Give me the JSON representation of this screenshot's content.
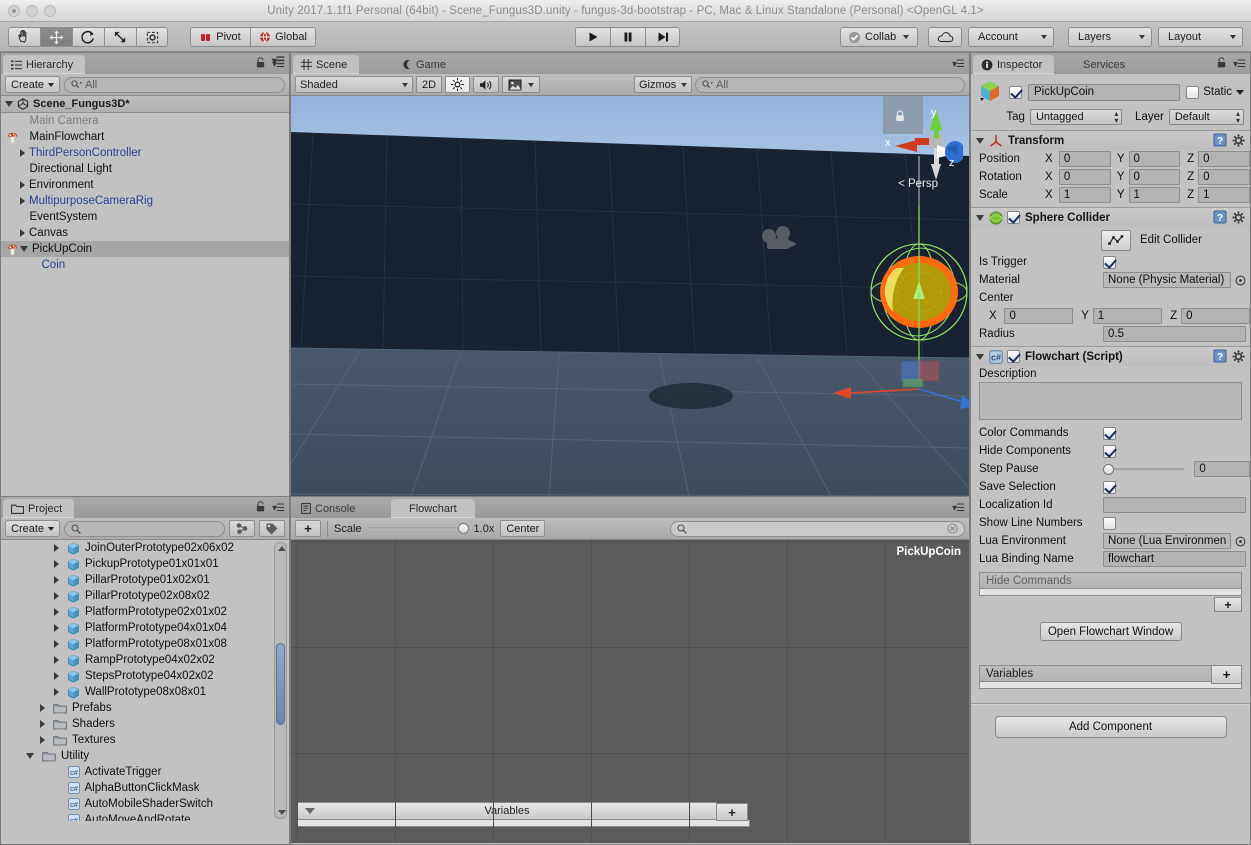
{
  "window": {
    "title": "Unity 2017.1.1f1 Personal (64bit) - Scene_Fungus3D.unity - fungus-3d-bootstrap - PC, Mac & Linux Standalone (Personal) <OpenGL 4.1>"
  },
  "toolbar": {
    "tools": [
      "hand-tool",
      "move-tool",
      "rotate-tool",
      "scale-tool",
      "rect-tool"
    ],
    "pivot_label": "Pivot",
    "global_label": "Global",
    "play_label": "play",
    "pause_label": "pause",
    "step_label": "step",
    "collab_label": "Collab",
    "cloud_label": "cloud",
    "account_label": "Account",
    "layers_label": "Layers",
    "layout_label": "Layout"
  },
  "hierarchy": {
    "tab_label": "Hierarchy",
    "create_label": "Create",
    "search_placeholder": "All",
    "scene_name": "Scene_Fungus3D*",
    "items": [
      {
        "label": "Main Camera",
        "indent": 1,
        "arrow": false,
        "icon": "none",
        "style": "dim",
        "selected": false
      },
      {
        "label": "MainFlowchart",
        "indent": 1,
        "arrow": false,
        "icon": "mushroom",
        "style": "normal",
        "selected": false
      },
      {
        "label": "ThirdPersonController",
        "indent": 1,
        "arrow": true,
        "icon": "none",
        "style": "prefab",
        "selected": false
      },
      {
        "label": "Directional Light",
        "indent": 1,
        "arrow": false,
        "icon": "none",
        "style": "normal",
        "selected": false
      },
      {
        "label": "Environment",
        "indent": 1,
        "arrow": true,
        "icon": "none",
        "style": "normal",
        "selected": false
      },
      {
        "label": "MultipurposeCameraRig",
        "indent": 1,
        "arrow": true,
        "icon": "none",
        "style": "prefab",
        "selected": false
      },
      {
        "label": "EventSystem",
        "indent": 1,
        "arrow": false,
        "icon": "none",
        "style": "normal",
        "selected": false
      },
      {
        "label": "Canvas",
        "indent": 1,
        "arrow": true,
        "icon": "none",
        "style": "normal",
        "selected": false
      },
      {
        "label": "PickUpCoin",
        "indent": 1,
        "arrow": true,
        "arrow_open": true,
        "icon": "mushroom",
        "style": "normal",
        "selected": true
      },
      {
        "label": "Coin",
        "indent": 2,
        "arrow": false,
        "icon": "none",
        "style": "prefab",
        "selected": false
      }
    ]
  },
  "project": {
    "tab_label": "Project",
    "create_label": "Create",
    "search_placeholder": "",
    "items": [
      {
        "label": "JoinOuterPrototype02x06x02",
        "indent": 3,
        "arrow": true,
        "icon": "prefab"
      },
      {
        "label": "PickupPrototype01x01x01",
        "indent": 3,
        "arrow": true,
        "icon": "prefab"
      },
      {
        "label": "PillarPrototype01x02x01",
        "indent": 3,
        "arrow": true,
        "icon": "prefab"
      },
      {
        "label": "PillarPrototype02x08x02",
        "indent": 3,
        "arrow": true,
        "icon": "prefab"
      },
      {
        "label": "PlatformPrototype02x01x02",
        "indent": 3,
        "arrow": true,
        "icon": "prefab"
      },
      {
        "label": "PlatformPrototype04x01x04",
        "indent": 3,
        "arrow": true,
        "icon": "prefab"
      },
      {
        "label": "PlatformPrototype08x01x08",
        "indent": 3,
        "arrow": true,
        "icon": "prefab"
      },
      {
        "label": "RampPrototype04x02x02",
        "indent": 3,
        "arrow": true,
        "icon": "prefab"
      },
      {
        "label": "StepsPrototype04x02x02",
        "indent": 3,
        "arrow": true,
        "icon": "prefab"
      },
      {
        "label": "WallPrototype08x08x01",
        "indent": 3,
        "arrow": true,
        "icon": "prefab"
      },
      {
        "label": "Prefabs",
        "indent": 2,
        "arrow": true,
        "icon": "folder"
      },
      {
        "label": "Shaders",
        "indent": 2,
        "arrow": true,
        "icon": "folder"
      },
      {
        "label": "Textures",
        "indent": 2,
        "arrow": true,
        "icon": "folder"
      },
      {
        "label": "Utility",
        "indent": 1,
        "arrow": true,
        "arrow_open": true,
        "icon": "folder"
      },
      {
        "label": "ActivateTrigger",
        "indent": 3,
        "arrow": false,
        "icon": "script"
      },
      {
        "label": "AlphaButtonClickMask",
        "indent": 3,
        "arrow": false,
        "icon": "script"
      },
      {
        "label": "AutoMobileShaderSwitch",
        "indent": 3,
        "arrow": false,
        "icon": "script"
      },
      {
        "label": "AutoMoveAndRotate",
        "indent": 3,
        "arrow": false,
        "icon": "script"
      }
    ]
  },
  "scene": {
    "tab_label": "Scene",
    "game_tab_label": "Game",
    "shading_mode": "Shaded",
    "twod_label": "2D",
    "light_label": "light-toggle",
    "audio_label": "audio-toggle",
    "fx_label": "effects-toggle",
    "gizmos_label": "Gizmos",
    "search_placeholder": "All",
    "axis_x": "x",
    "axis_y": "y",
    "axis_z": "z",
    "persp_label": "Persp"
  },
  "console": {
    "console_tab_label": "Console",
    "flowchart_tab_label": "Flowchart",
    "add_label": "+",
    "scale_label": "Scale",
    "scale_value": "1.0x",
    "center_label": "Center",
    "search_placeholder": "",
    "flowchart_name": "PickUpCoin",
    "variables_label": "Variables",
    "variables_add_label": "+"
  },
  "inspector": {
    "tab_label": "Inspector",
    "services_tab_label": "Services",
    "object_name": "PickUpCoin",
    "static_label": "Static",
    "tag_label": "Tag",
    "tag_value": "Untagged",
    "layer_label": "Layer",
    "layer_value": "Default",
    "transform": {
      "title": "Transform",
      "rows": [
        {
          "label": "Position",
          "x": "0",
          "y": "0",
          "z": "0"
        },
        {
          "label": "Rotation",
          "x": "0",
          "y": "0",
          "z": "0"
        },
        {
          "label": "Scale",
          "x": "1",
          "y": "1",
          "z": "1"
        }
      ],
      "axis_labels": [
        "X",
        "Y",
        "Z"
      ]
    },
    "sphere_collider": {
      "title": "Sphere Collider",
      "edit_collider_label": "Edit Collider",
      "is_trigger_label": "Is Trigger",
      "is_trigger_checked": true,
      "material_label": "Material",
      "material_value": "None (Physic Material)",
      "center_label": "Center",
      "center_x": "0",
      "center_y": "1",
      "center_z": "0",
      "radius_label": "Radius",
      "radius_value": "0.5"
    },
    "flowchart": {
      "title": "Flowchart (Script)",
      "description_label": "Description",
      "description_value": "",
      "color_commands_label": "Color Commands",
      "color_commands_checked": true,
      "hide_components_label": "Hide Components",
      "hide_components_checked": true,
      "step_pause_label": "Step Pause",
      "step_pause_value": "0",
      "save_selection_label": "Save Selection",
      "save_selection_checked": true,
      "localization_id_label": "Localization Id",
      "localization_id_value": "",
      "show_line_numbers_label": "Show Line Numbers",
      "show_line_numbers_checked": false,
      "lua_environment_label": "Lua Environment",
      "lua_environment_value": "None (Lua Environmen",
      "lua_binding_name_label": "Lua Binding Name",
      "lua_binding_name_value": "flowchart",
      "hide_commands_label": "Hide Commands",
      "hide_commands_add_label": "+",
      "open_window_label": "Open Flowchart Window",
      "variables_label": "Variables",
      "variables_add_label": "+"
    },
    "add_component_label": "Add Component"
  }
}
